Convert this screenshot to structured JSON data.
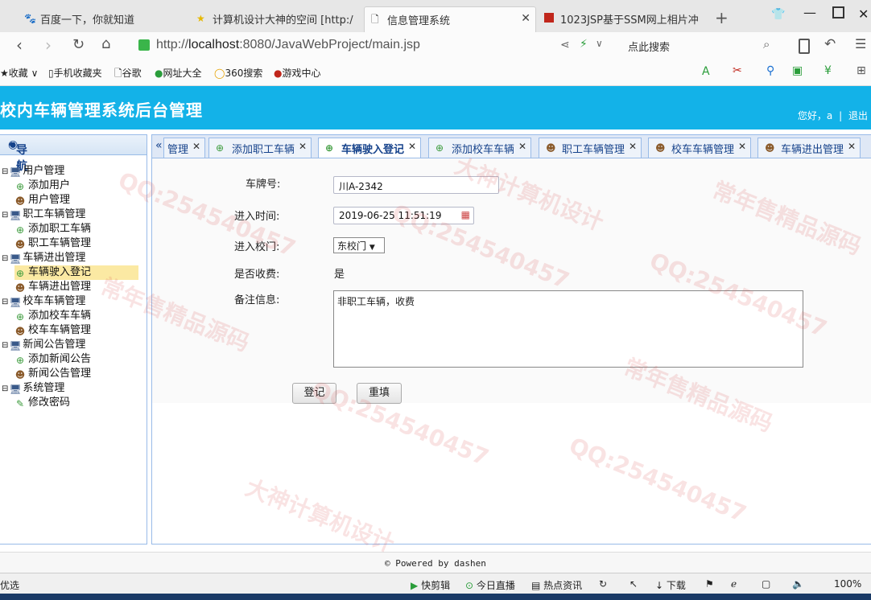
{
  "browser": {
    "tabs": [
      {
        "label": "百度一下，你就知道",
        "icon": "paw-icon"
      },
      {
        "label": "计算机设计大神的空间 [http:/",
        "icon": "star-icon"
      },
      {
        "label": "信息管理系统",
        "icon": "page-icon",
        "active": true
      },
      {
        "label": "1023JSP基于SSM网上相片冲",
        "icon": "red-square-icon"
      }
    ],
    "new_tab": "+",
    "url_base": "http://",
    "url_host": "localhost",
    "url_path": ":8080/JavaWebProject/main.jsp",
    "search_label": "点此搜索",
    "bookmarks": [
      "收藏",
      "手机收藏夹",
      "谷歌",
      "网址大全",
      "360搜索",
      "游戏中心"
    ]
  },
  "header": {
    "title": "校内车辆管理系统后台管理",
    "greeting": "您好，a",
    "logout": "退出"
  },
  "sidebar": {
    "title": "导航",
    "collapse": "«",
    "tree": [
      {
        "label": "用户管理",
        "level": 0
      },
      {
        "label": "添加用户",
        "level": 1,
        "icon": "add"
      },
      {
        "label": "用户管理",
        "level": 1,
        "icon": "user"
      },
      {
        "label": "职工车辆管理",
        "level": 0
      },
      {
        "label": "添加职工车辆",
        "level": 1,
        "icon": "add"
      },
      {
        "label": "职工车辆管理",
        "level": 1,
        "icon": "user"
      },
      {
        "label": "车辆进出管理",
        "level": 0
      },
      {
        "label": "车辆驶入登记",
        "level": 1,
        "icon": "add",
        "selected": true
      },
      {
        "label": "车辆进出管理",
        "level": 1,
        "icon": "user"
      },
      {
        "label": "校车车辆管理",
        "level": 0
      },
      {
        "label": "添加校车车辆",
        "level": 1,
        "icon": "add"
      },
      {
        "label": "校车车辆管理",
        "level": 1,
        "icon": "user"
      },
      {
        "label": "新闻公告管理",
        "level": 0
      },
      {
        "label": "添加新闻公告",
        "level": 1,
        "icon": "add"
      },
      {
        "label": "新闻公告管理",
        "level": 1,
        "icon": "user"
      },
      {
        "label": "系统管理",
        "level": 0
      },
      {
        "label": "修改密码",
        "level": 1,
        "icon": "pencil"
      }
    ]
  },
  "panel_tabs": [
    {
      "label": "管理",
      "icon": ""
    },
    {
      "label": "添加职工车辆",
      "icon": "add"
    },
    {
      "label": "车辆驶入登记",
      "icon": "add",
      "active": true
    },
    {
      "label": "添加校车车辆",
      "icon": "add"
    },
    {
      "label": "职工车辆管理",
      "icon": "user"
    },
    {
      "label": "校车车辆管理",
      "icon": "user"
    },
    {
      "label": "车辆进出管理",
      "icon": "user"
    }
  ],
  "form": {
    "plate_label": "车牌号:",
    "plate_value": "川A-2342",
    "time_label": "进入时间:",
    "time_value": "2019-06-25 11:51:19",
    "gate_label": "进入校门:",
    "gate_value": "东校门",
    "fee_label": "是否收费:",
    "fee_value": "是",
    "remark_label": "备注信息:",
    "remark_value": "非职工车辆，收费",
    "submit": "登记",
    "reset": "重填"
  },
  "footer": {
    "text": "© Powered by dashen"
  },
  "statusbar": {
    "left": "优选",
    "items": [
      "快剪辑",
      "今日直播",
      "热点资讯",
      "下载"
    ],
    "zoom": "100%"
  },
  "watermarks": [
    "QQ:254540457",
    "大神计算机设计",
    "常年售精品源码"
  ]
}
